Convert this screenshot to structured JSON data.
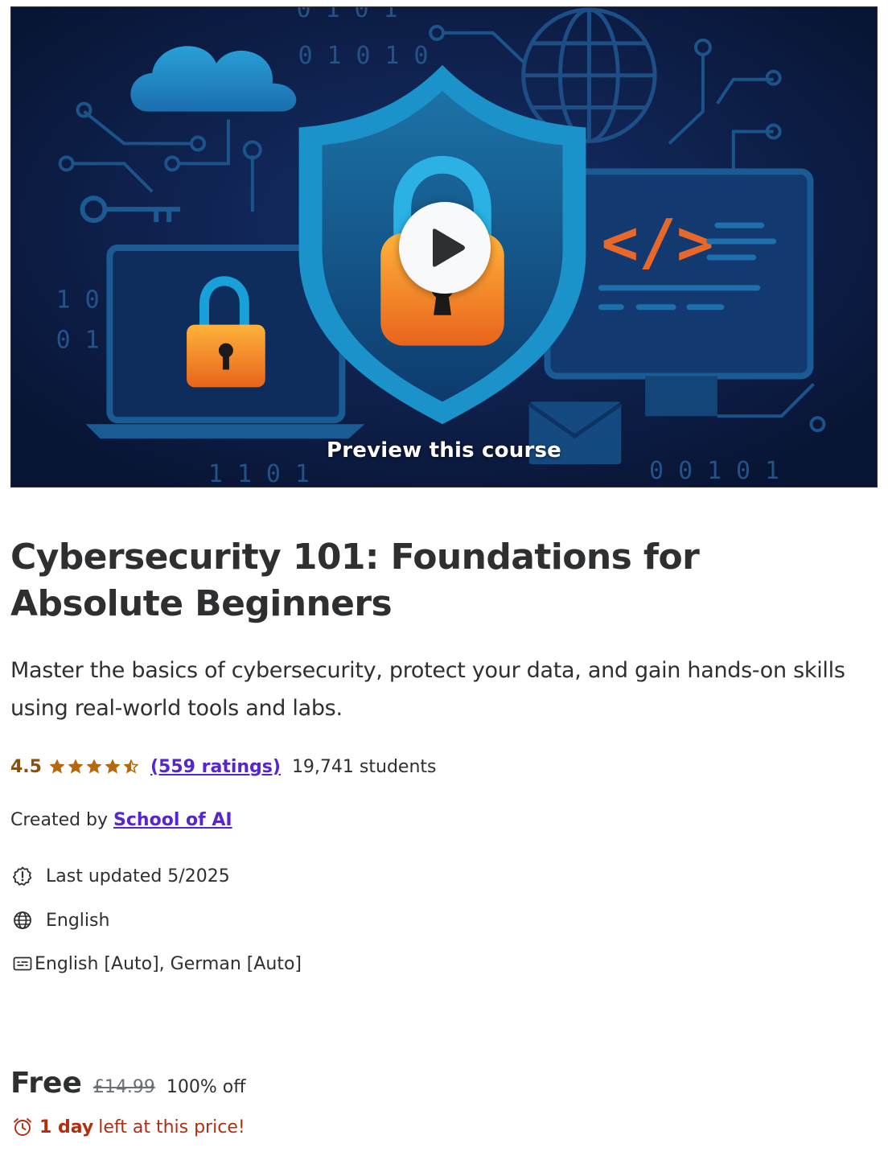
{
  "preview": {
    "label": "Preview this course",
    "binary_top": "0 1 0 1 0",
    "binary_top_partial": "0 1 0 1",
    "binary_left_1": "1 0",
    "binary_left_2": "0 1",
    "binary_bottom_left": "1 1 0 1",
    "binary_bottom_right": "0 0 1 0 1",
    "code_glyph": "</>"
  },
  "course": {
    "title": "Cybersecurity 101: Foundations for Absolute Beginners",
    "subtitle": "Master the basics of cybersecurity, protect your data, and gain hands-on skills using real-world tools and labs."
  },
  "rating": {
    "value": "4.5",
    "stars": 4.5,
    "ratings_link": "(559 ratings)",
    "students": "19,741 students",
    "star_color": "#b4690e"
  },
  "creator": {
    "prefix": "Created by",
    "name": "School of AI"
  },
  "meta": {
    "last_updated": "Last updated 5/2025",
    "language": "English",
    "captions": "English [Auto], German [Auto]"
  },
  "pricing": {
    "current": "Free",
    "original": "£14.99",
    "discount": "100% off",
    "deadline_bold": "1 day",
    "deadline_rest": "left at this price!"
  },
  "colors": {
    "accent_link": "#5624d0",
    "rating_text": "#8c4f0d",
    "deadline": "#b32d0f",
    "text": "#2d2f31"
  },
  "icons": {
    "last_updated": "alert-badge-icon",
    "language": "globe-icon",
    "captions": "closed-captions-icon",
    "deadline": "alarm-clock-icon",
    "play": "play-icon"
  }
}
